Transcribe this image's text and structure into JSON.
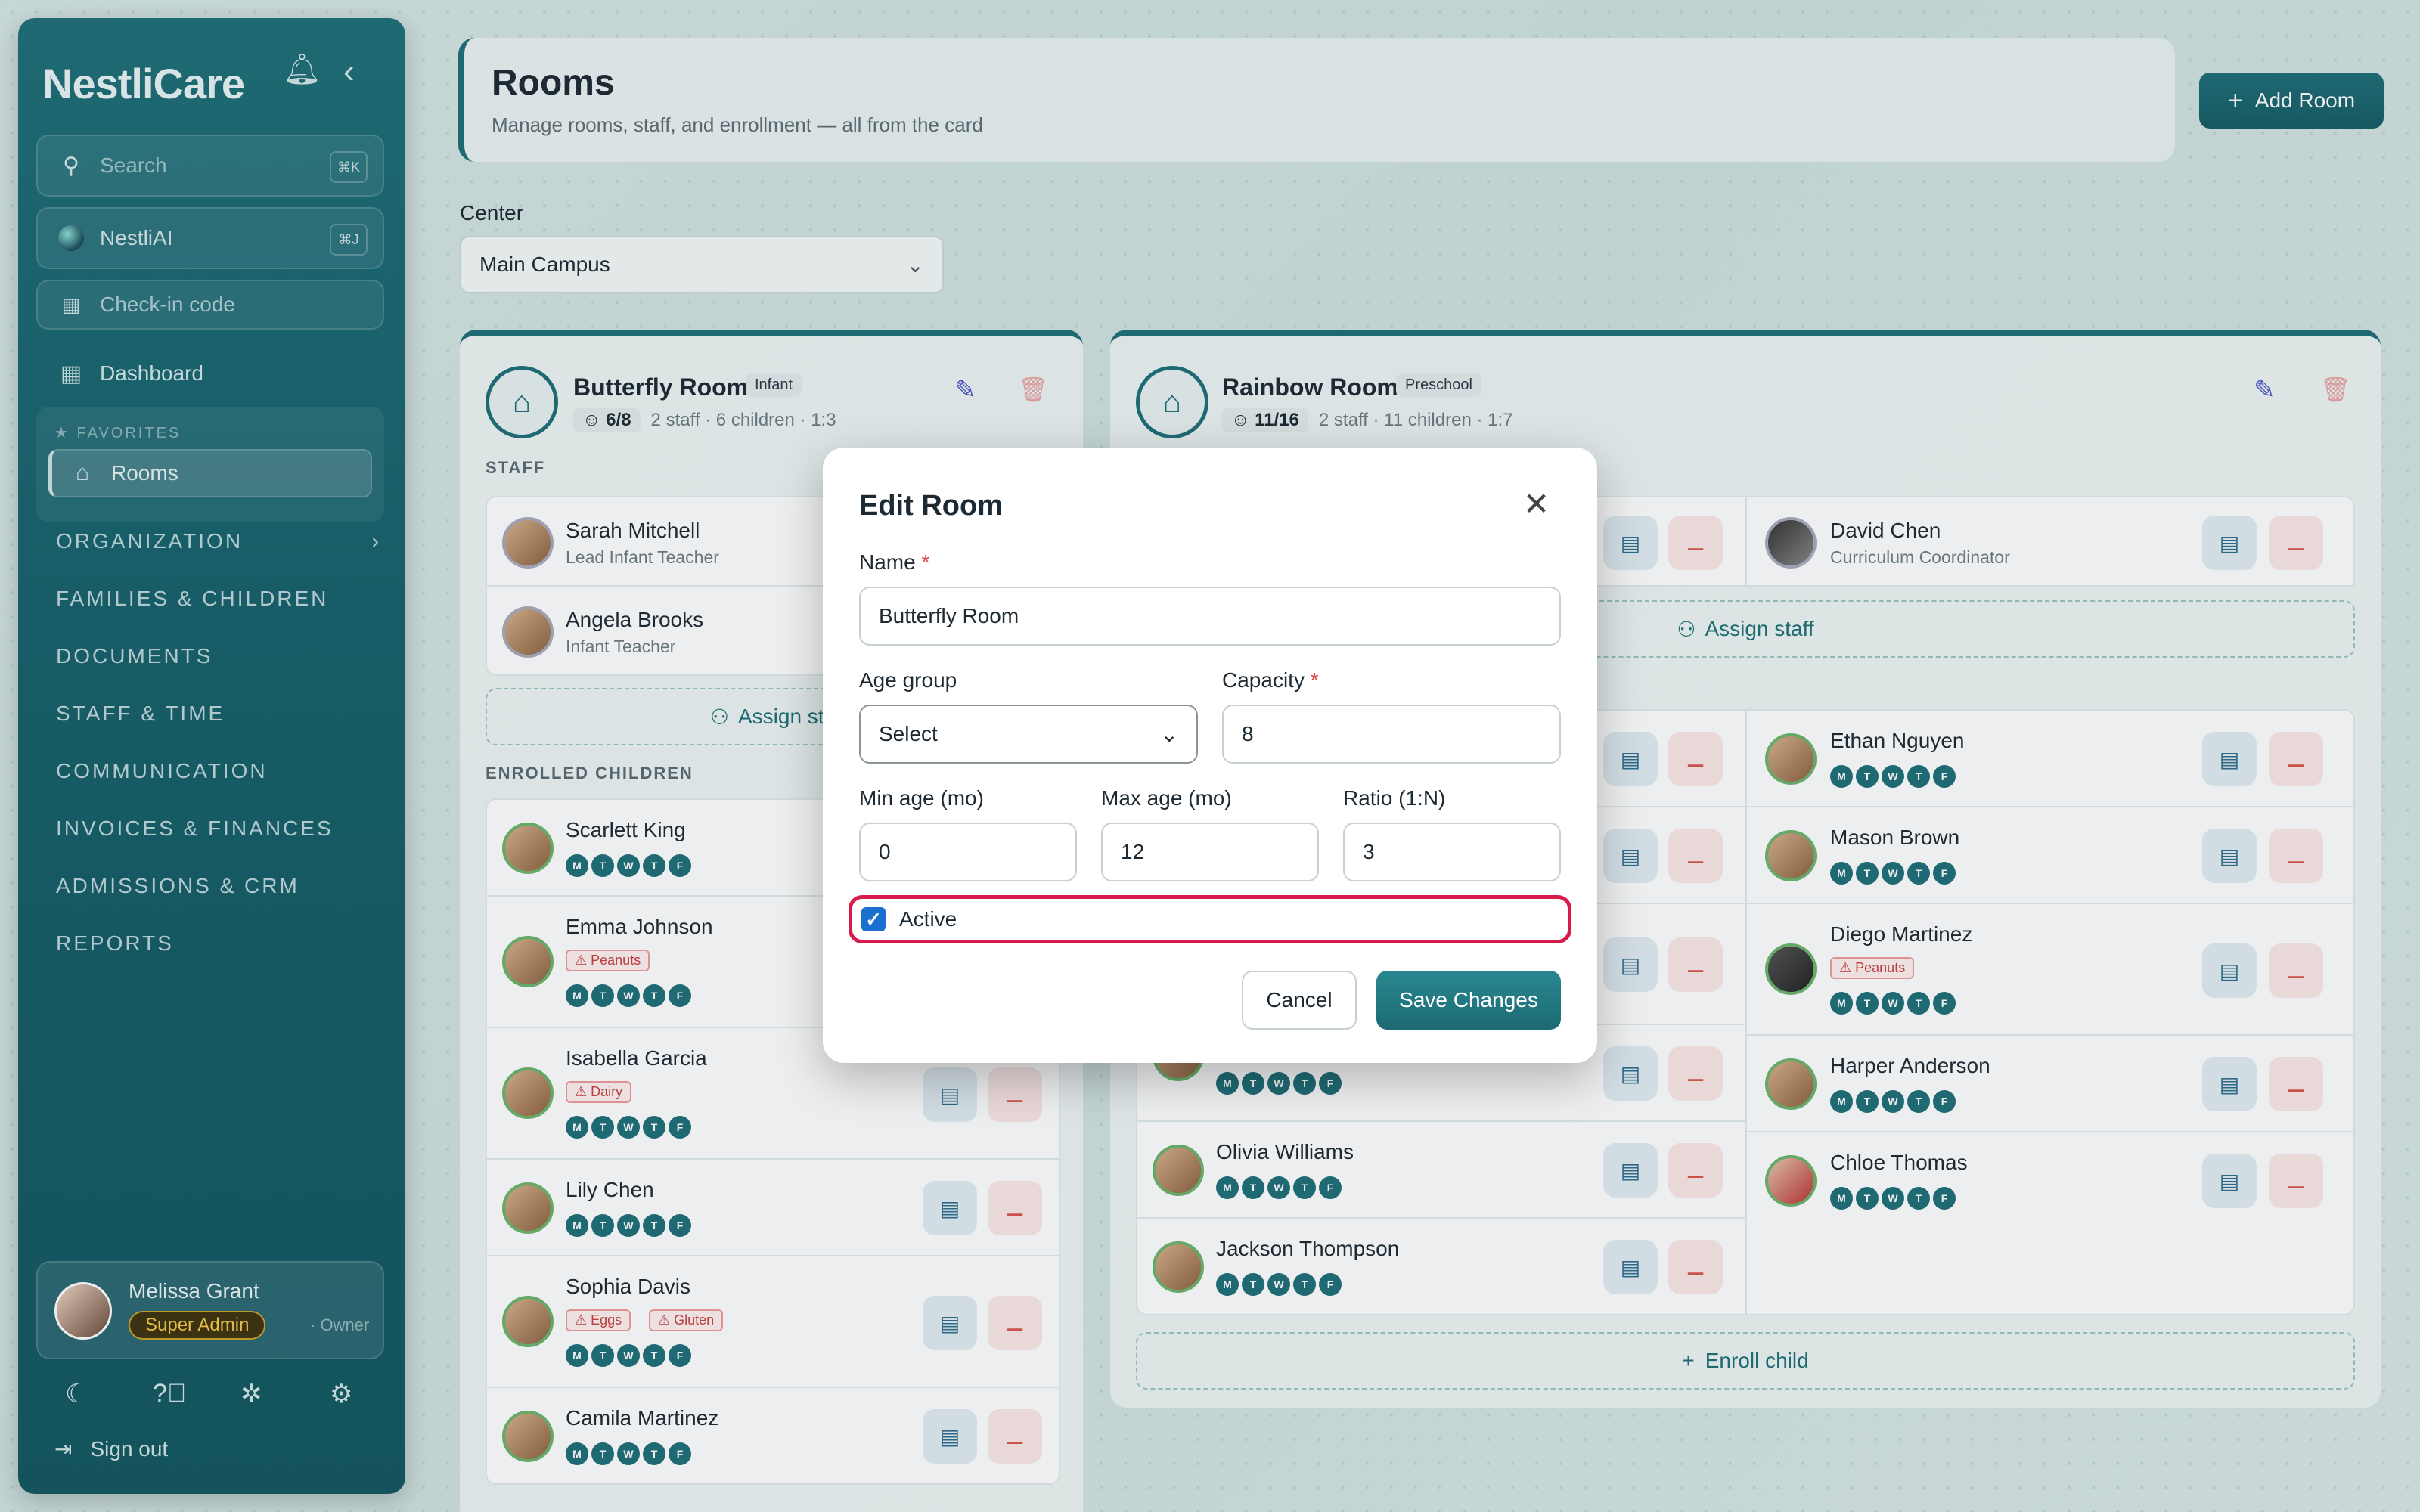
{
  "sidebar": {
    "brand": "NestliCare",
    "search_placeholder": "Search",
    "search_shortcut": "⌘K",
    "ai_label": "NestliAI",
    "ai_shortcut": "⌘J",
    "checkin_label": "Check-in code",
    "dashboard_label": "Dashboard",
    "favorites_label": "FAVORITES",
    "rooms_label": "Rooms",
    "nav": [
      "ORGANIZATION",
      "FAMILIES & CHILDREN",
      "DOCUMENTS",
      "STAFF & TIME",
      "COMMUNICATION",
      "INVOICES & FINANCES",
      "ADMISSIONS & CRM",
      "REPORTS"
    ],
    "user": {
      "name": "Melissa Grant",
      "role": "Super Admin",
      "title": "· Owner"
    },
    "signout": "Sign out"
  },
  "header": {
    "title": "Rooms",
    "subtitle": "Manage rooms, staff, and enrollment — all from the card",
    "add_button": "Add Room"
  },
  "center": {
    "label": "Center",
    "value": "Main Campus"
  },
  "butterfly": {
    "name": "Butterfly Room",
    "tag": "Infant",
    "count": "6/8",
    "meta": "2 staff · 6 children · 1:3",
    "staff_label": "STAFF",
    "enrolled_label": "ENROLLED CHILDREN",
    "assign": "Assign sta",
    "staff": [
      {
        "name": "Sarah Mitchell",
        "role": "Lead Infant Teacher"
      },
      {
        "name": "Angela Brooks",
        "role": "Infant Teacher"
      }
    ],
    "children": [
      {
        "name": "Scarlett King",
        "allergies": []
      },
      {
        "name": "Emma Johnson",
        "allergies": [
          "Peanuts"
        ]
      },
      {
        "name": "Isabella Garcia",
        "allergies": [
          "Dairy"
        ]
      },
      {
        "name": "Lily Chen",
        "allergies": []
      },
      {
        "name": "Sophia Davis",
        "allergies": [
          "Eggs",
          "Gluten"
        ]
      },
      {
        "name": "Camila Martinez",
        "allergies": []
      }
    ]
  },
  "rainbow": {
    "name": "Rainbow Room",
    "tag": "Preschool",
    "count": "11/16",
    "meta": "2 staff · 11 children · 1:7",
    "staff": [
      {
        "name": "David Chen",
        "role": "Curriculum Coordinator"
      }
    ],
    "assign": "Assign staff",
    "left_children": [
      {
        "name": "Olivia Williams"
      },
      {
        "name": "Jackson Thompson"
      }
    ],
    "right_children": [
      {
        "name": "Ethan Nguyen",
        "allergies": []
      },
      {
        "name": "Mason Brown",
        "allergies": []
      },
      {
        "name": "Diego Martinez",
        "allergies": [
          "Peanuts"
        ]
      },
      {
        "name": "Harper Anderson",
        "allergies": []
      },
      {
        "name": "Chloe Thomas",
        "allergies": []
      }
    ],
    "enroll": "Enroll child"
  },
  "days": [
    "M",
    "T",
    "W",
    "T",
    "F"
  ],
  "modal": {
    "title": "Edit Room",
    "name_label": "Name",
    "name_value": "Butterfly Room",
    "age_label": "Age group",
    "age_value": "Select",
    "capacity_label": "Capacity",
    "capacity_value": "8",
    "min_label": "Min age (mo)",
    "min_value": "0",
    "max_label": "Max age (mo)",
    "max_value": "12",
    "ratio_label": "Ratio (1:N)",
    "ratio_value": "3",
    "active_label": "Active",
    "active": true,
    "cancel": "Cancel",
    "save": "Save Changes"
  },
  "colors": {
    "primary": "#1f6f78",
    "danger": "#e0484f",
    "highlight": "#d81b4a"
  }
}
